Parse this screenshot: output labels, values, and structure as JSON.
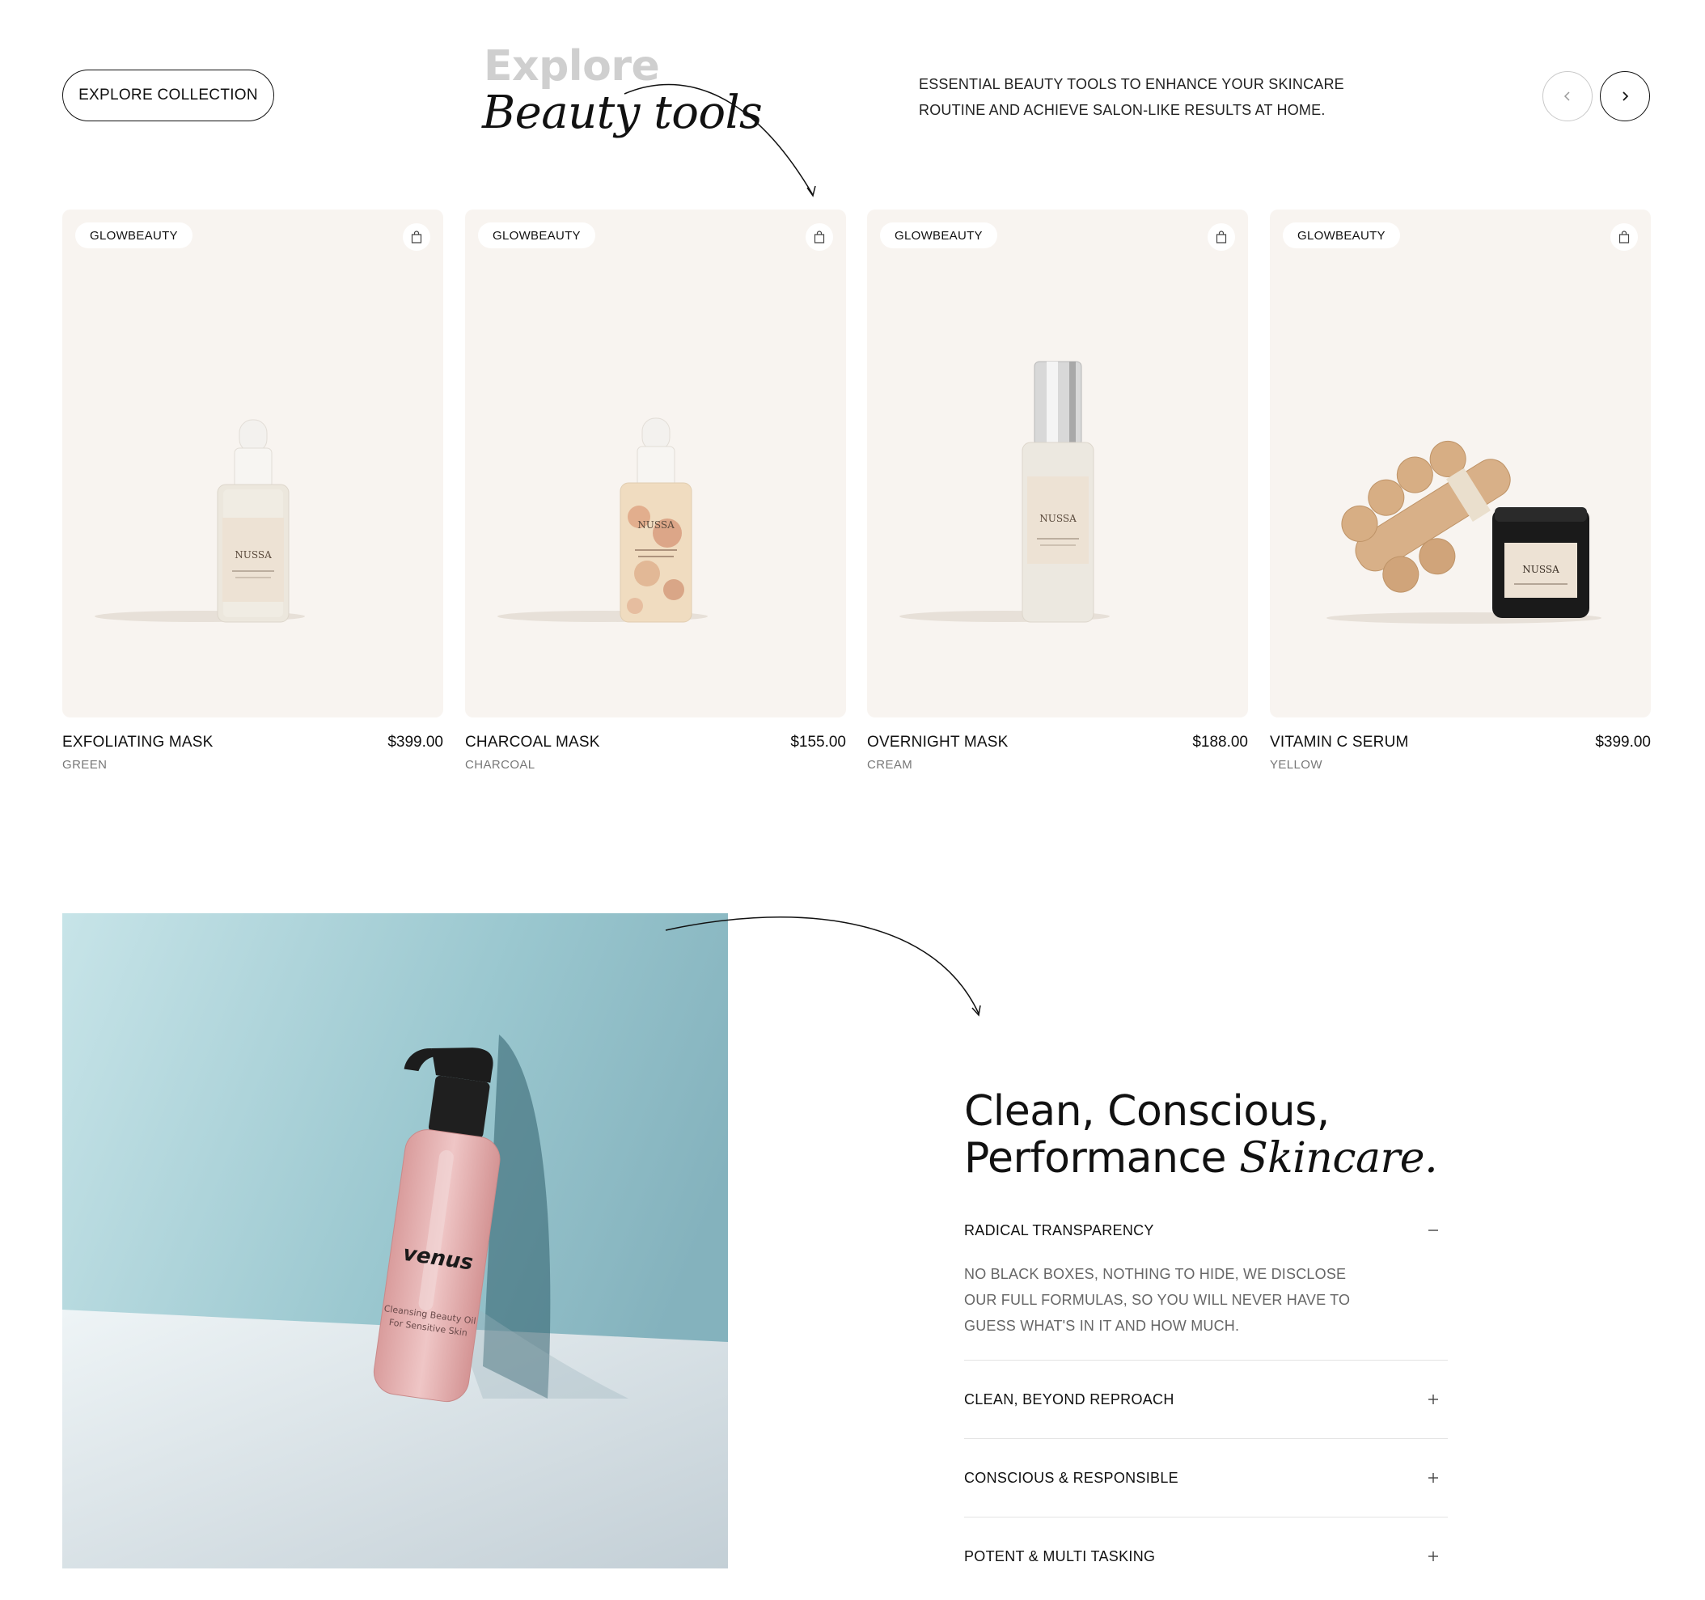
{
  "header": {
    "explore_button": "EXPLORE COLLECTION",
    "kicker": "Explore",
    "title": "Beauty tools",
    "description": "ESSENTIAL BEAUTY TOOLS TO ENHANCE YOUR SKINCARE ROUTINE AND ACHIEVE SALON-LIKE RESULTS AT HOME.",
    "prev_icon": "chevron-left-icon",
    "next_icon": "chevron-right-icon"
  },
  "products": [
    {
      "badge": "GLOWBEAUTY",
      "name": "EXFOLIATING MASK",
      "price": "$399.00",
      "variant": "GREEN",
      "image": "dropper-bottle",
      "label_text": "NUSSA"
    },
    {
      "badge": "GLOWBEAUTY",
      "name": "CHARCOAL MASK",
      "price": "$155.00",
      "variant": "CHARCOAL",
      "image": "floral-oil-bottle",
      "label_text": "NUSSA"
    },
    {
      "badge": "GLOWBEAUTY",
      "name": "OVERNIGHT MASK",
      "price": "$188.00",
      "variant": "CREAM",
      "image": "spray-bottle",
      "label_text": "NUSSA"
    },
    {
      "badge": "GLOWBEAUTY",
      "name": "VITAMIN C SERUM",
      "price": "$399.00",
      "variant": "YELLOW",
      "image": "wood-massager-and-jar",
      "label_text": "NUSSA"
    }
  ],
  "feature": {
    "title_line1": "Clean, Conscious,",
    "title_line2": "Performance",
    "title_italic": "Skincare.",
    "image": "pump-bottle-on-blue-wall",
    "bottle_brand": "venus",
    "bottle_text_1": "Cleansing Beauty Oil",
    "bottle_text_2": "For Sensitive Skin",
    "accordion": [
      {
        "label": "RADICAL TRANSPARENCY",
        "expanded": true,
        "body": "NO BLACK BOXES, NOTHING TO HIDE, WE DISCLOSE OUR FULL FORMULAS, SO YOU WILL NEVER HAVE TO GUESS WHAT'S IN IT AND HOW MUCH."
      },
      {
        "label": "CLEAN, BEYOND REPROACH",
        "expanded": false
      },
      {
        "label": "CONSCIOUS & RESPONSIBLE",
        "expanded": false
      },
      {
        "label": "POTENT & MULTI TASKING",
        "expanded": false
      }
    ]
  },
  "colors": {
    "card_bg": "#f8f4f0",
    "muted_text": "#777777",
    "accent_blue": "#8fbcc6",
    "bottle_pink": "#e7b3b3"
  }
}
